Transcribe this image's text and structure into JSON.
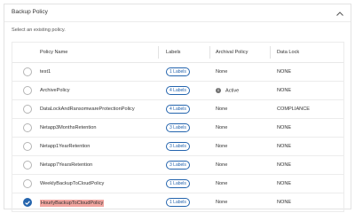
{
  "panel": {
    "title": "Backup Policy",
    "subtitle": "Select an existing policy."
  },
  "table": {
    "headers": {
      "name": "Policy Name",
      "labels": "Labels",
      "archival": "Archival Policy",
      "lock": "Data Lock"
    },
    "rows": [
      {
        "name": "test1",
        "labels": "1 Labels",
        "archival": "None",
        "lock": "NONE",
        "selected": false
      },
      {
        "name": "ArchivePolicy",
        "labels": "4 Labels",
        "archival": "Active",
        "lock": "NONE",
        "selected": false
      },
      {
        "name": "DataLockAndRansomwareProtectionPolicy",
        "labels": "4 Labels",
        "archival": "None",
        "lock": "COMPLIANCE",
        "selected": false
      },
      {
        "name": "Netapp3MonthsRetention",
        "labels": "3 Labels",
        "archival": "None",
        "lock": "NONE",
        "selected": false
      },
      {
        "name": "Netapp1YearRetention",
        "labels": "3 Labels",
        "archival": "None",
        "lock": "NONE",
        "selected": false
      },
      {
        "name": "Netapp7YearsRetention",
        "labels": "3 Labels",
        "archival": "None",
        "lock": "NONE",
        "selected": false
      },
      {
        "name": "WeeklyBackupToCloudPolicy",
        "labels": "1 Labels",
        "archival": "None",
        "lock": "NONE",
        "selected": false
      },
      {
        "name": "HourlyBackupToCloudPolicy",
        "labels": "1 Labels",
        "archival": "None",
        "lock": "NONE",
        "selected": true
      }
    ]
  },
  "icons": {
    "collapse": "chevron-up-icon",
    "info": "info-icon",
    "selected": "check-icon"
  },
  "colors": {
    "accent": "#2565ae",
    "highlight": "#f2a5a0"
  }
}
